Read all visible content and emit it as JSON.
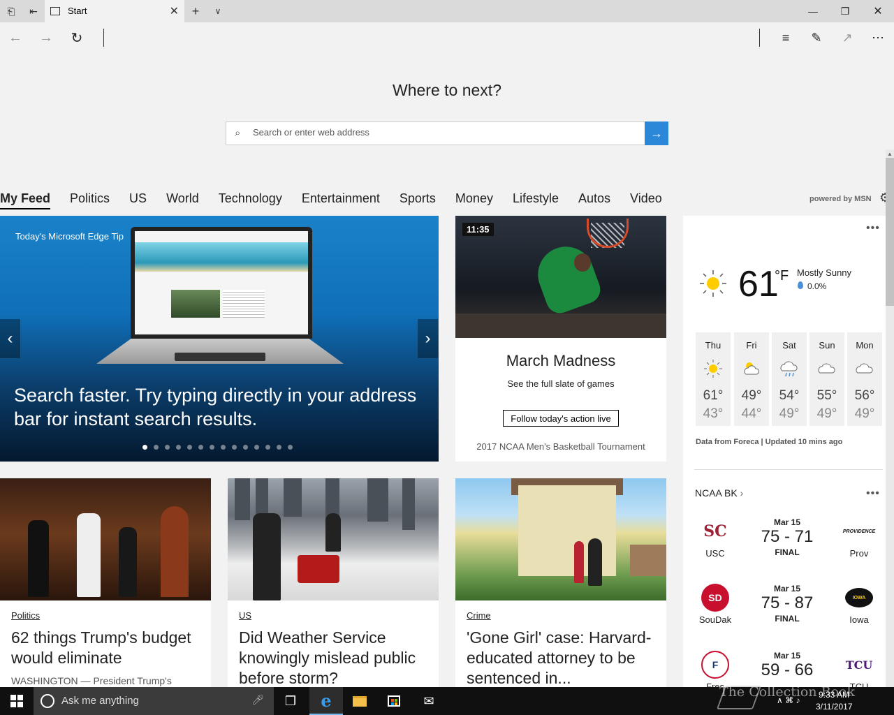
{
  "tab": {
    "title": "Start"
  },
  "hero": {
    "heading": "Where to next?",
    "search_placeholder": "Search or enter web address"
  },
  "categories": [
    "My Feed",
    "Politics",
    "US",
    "World",
    "Technology",
    "Entertainment",
    "Sports",
    "Money",
    "Lifestyle",
    "Autos",
    "Video"
  ],
  "powered_by": "powered by MSN",
  "carousel": {
    "tip_label": "Today's Microsoft Edge Tip",
    "headline": "Search faster. Try typing directly in your address bar for instant search results.",
    "dot_count": 14,
    "active_dot": 0
  },
  "promo": {
    "scoreboard": "11:35",
    "title": "March Madness",
    "subtitle": "See the full slate of games",
    "button": "Follow today's action live",
    "footer": "2017 NCAA Men's Basketball Tournament"
  },
  "news": [
    {
      "category": "Politics",
      "headline": "62 things Trump's budget would eliminate",
      "snippet": "WASHINGTON — President Trump's"
    },
    {
      "category": "US",
      "headline": "Did Weather Service knowingly mislead public before storm?",
      "snippet": ""
    },
    {
      "category": "Crime",
      "headline": "'Gone Girl' case: Harvard-educated attorney to be sentenced in...",
      "snippet": ""
    }
  ],
  "weather": {
    "temp": "61",
    "unit": "°F",
    "condition": "Mostly Sunny",
    "precip": "0.0%",
    "forecast": [
      {
        "day": "Thu",
        "hi": "61°",
        "lo": "43°",
        "icon": "sunny-icon"
      },
      {
        "day": "Fri",
        "hi": "49°",
        "lo": "44°",
        "icon": "partly-cloudy-icon"
      },
      {
        "day": "Sat",
        "hi": "54°",
        "lo": "49°",
        "icon": "rain-icon"
      },
      {
        "day": "Sun",
        "hi": "55°",
        "lo": "49°",
        "icon": "cloudy-icon"
      },
      {
        "day": "Mon",
        "hi": "56°",
        "lo": "49°",
        "icon": "cloudy-icon"
      }
    ],
    "source": "Data from Foreca | Updated 10 mins ago"
  },
  "scores": {
    "title": "NCAA BK",
    "games": [
      {
        "home": "USC",
        "away": "Prov",
        "date": "Mar 15",
        "score": "75 - 71",
        "status": "FINAL",
        "home_color": "#9d2235",
        "away_color": "#111111"
      },
      {
        "home": "SouDak",
        "away": "Iowa",
        "date": "Mar 15",
        "score": "75 - 87",
        "status": "FINAL",
        "home_color": "#c8102e",
        "away_color": "#ffcd00"
      },
      {
        "home": "Fres",
        "away": "TCU",
        "date": "Mar 15",
        "score": "59 - 66",
        "status": "",
        "home_color": "#c8102e",
        "away_color": "#4d1979"
      }
    ],
    "logo_text": [
      "SC",
      "PROVIDENCE",
      "SD",
      "IOWA",
      "F",
      "TCU"
    ]
  },
  "taskbar": {
    "search_placeholder": "Ask me anything",
    "time": "9:33 AM",
    "date": "3/11/2017"
  },
  "watermark": "The Collection Book"
}
